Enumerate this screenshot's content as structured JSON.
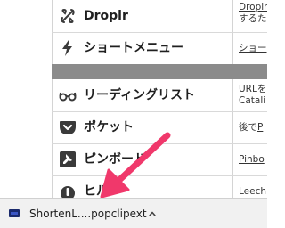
{
  "rows": [
    {
      "name": "Droplr",
      "desc_line1": "Droplr",
      "desc_line2": "するた"
    },
    {
      "name": "ショートメニュー",
      "desc_line1": "ショー"
    },
    {
      "name": "リーディングリスト",
      "desc_line1": "URLを",
      "desc_line2": "Catali"
    },
    {
      "name": "ポケット",
      "desc_prefix": "後で",
      "desc_link": "P"
    },
    {
      "name": "ピンボード",
      "desc_line1": "Pinbo"
    },
    {
      "name": "ヒル",
      "desc_line1": "Leech"
    }
  ],
  "download_bar": {
    "filename": "ShortenL....popclipext",
    "icon": "package-icon",
    "menu_icon": "chevron-up-icon"
  },
  "annotation": {
    "icon": "pink-arrow",
    "color": "#f0386b"
  },
  "colors": {
    "section_bar": "#8b8b8b",
    "download_bar_bg": "#f1f1f1"
  }
}
